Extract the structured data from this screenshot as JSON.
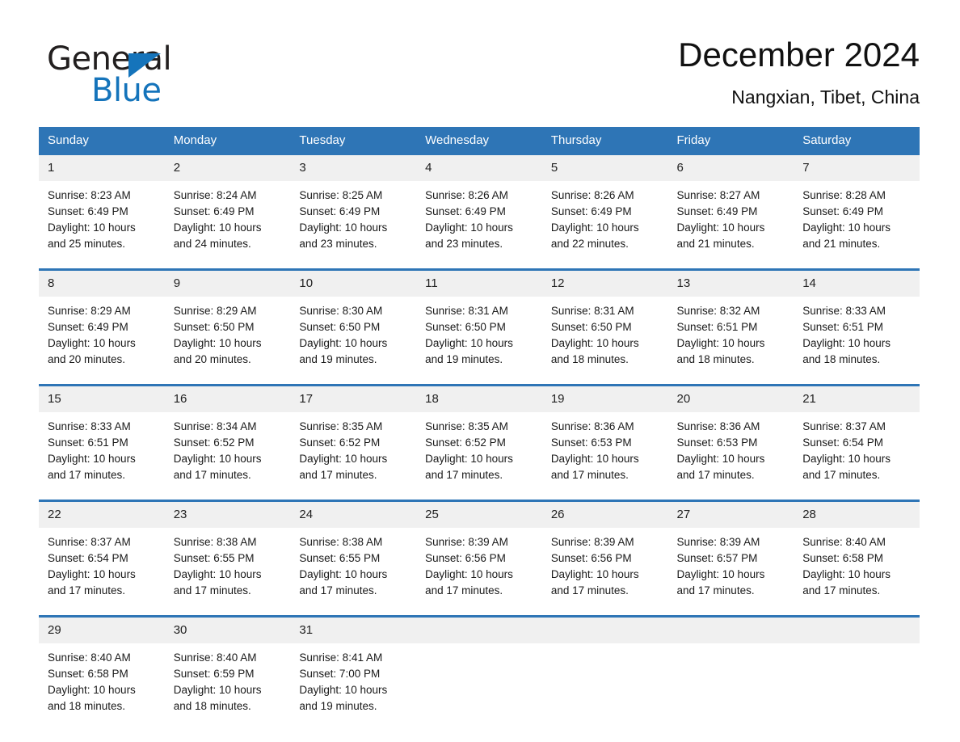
{
  "brand": {
    "name_part1": "General",
    "name_part2": "Blue",
    "triangle_color": "#1574bb",
    "text_color": "#221f1f"
  },
  "header": {
    "title": "December 2024",
    "subtitle": "Nangxian, Tibet, China"
  },
  "theme": {
    "header_bg": "#2e75b6",
    "header_text": "#ffffff",
    "daynum_bg": "#f0f0f0",
    "separator": "#2e75b6",
    "page_bg": "#ffffff"
  },
  "weekday_headers": [
    "Sunday",
    "Monday",
    "Tuesday",
    "Wednesday",
    "Thursday",
    "Friday",
    "Saturday"
  ],
  "weeks": [
    [
      {
        "day": "1",
        "sunrise": "Sunrise: 8:23 AM",
        "sunset": "Sunset: 6:49 PM",
        "daylight_1": "Daylight: 10 hours",
        "daylight_2": "and 25 minutes."
      },
      {
        "day": "2",
        "sunrise": "Sunrise: 8:24 AM",
        "sunset": "Sunset: 6:49 PM",
        "daylight_1": "Daylight: 10 hours",
        "daylight_2": "and 24 minutes."
      },
      {
        "day": "3",
        "sunrise": "Sunrise: 8:25 AM",
        "sunset": "Sunset: 6:49 PM",
        "daylight_1": "Daylight: 10 hours",
        "daylight_2": "and 23 minutes."
      },
      {
        "day": "4",
        "sunrise": "Sunrise: 8:26 AM",
        "sunset": "Sunset: 6:49 PM",
        "daylight_1": "Daylight: 10 hours",
        "daylight_2": "and 23 minutes."
      },
      {
        "day": "5",
        "sunrise": "Sunrise: 8:26 AM",
        "sunset": "Sunset: 6:49 PM",
        "daylight_1": "Daylight: 10 hours",
        "daylight_2": "and 22 minutes."
      },
      {
        "day": "6",
        "sunrise": "Sunrise: 8:27 AM",
        "sunset": "Sunset: 6:49 PM",
        "daylight_1": "Daylight: 10 hours",
        "daylight_2": "and 21 minutes."
      },
      {
        "day": "7",
        "sunrise": "Sunrise: 8:28 AM",
        "sunset": "Sunset: 6:49 PM",
        "daylight_1": "Daylight: 10 hours",
        "daylight_2": "and 21 minutes."
      }
    ],
    [
      {
        "day": "8",
        "sunrise": "Sunrise: 8:29 AM",
        "sunset": "Sunset: 6:49 PM",
        "daylight_1": "Daylight: 10 hours",
        "daylight_2": "and 20 minutes."
      },
      {
        "day": "9",
        "sunrise": "Sunrise: 8:29 AM",
        "sunset": "Sunset: 6:50 PM",
        "daylight_1": "Daylight: 10 hours",
        "daylight_2": "and 20 minutes."
      },
      {
        "day": "10",
        "sunrise": "Sunrise: 8:30 AM",
        "sunset": "Sunset: 6:50 PM",
        "daylight_1": "Daylight: 10 hours",
        "daylight_2": "and 19 minutes."
      },
      {
        "day": "11",
        "sunrise": "Sunrise: 8:31 AM",
        "sunset": "Sunset: 6:50 PM",
        "daylight_1": "Daylight: 10 hours",
        "daylight_2": "and 19 minutes."
      },
      {
        "day": "12",
        "sunrise": "Sunrise: 8:31 AM",
        "sunset": "Sunset: 6:50 PM",
        "daylight_1": "Daylight: 10 hours",
        "daylight_2": "and 18 minutes."
      },
      {
        "day": "13",
        "sunrise": "Sunrise: 8:32 AM",
        "sunset": "Sunset: 6:51 PM",
        "daylight_1": "Daylight: 10 hours",
        "daylight_2": "and 18 minutes."
      },
      {
        "day": "14",
        "sunrise": "Sunrise: 8:33 AM",
        "sunset": "Sunset: 6:51 PM",
        "daylight_1": "Daylight: 10 hours",
        "daylight_2": "and 18 minutes."
      }
    ],
    [
      {
        "day": "15",
        "sunrise": "Sunrise: 8:33 AM",
        "sunset": "Sunset: 6:51 PM",
        "daylight_1": "Daylight: 10 hours",
        "daylight_2": "and 17 minutes."
      },
      {
        "day": "16",
        "sunrise": "Sunrise: 8:34 AM",
        "sunset": "Sunset: 6:52 PM",
        "daylight_1": "Daylight: 10 hours",
        "daylight_2": "and 17 minutes."
      },
      {
        "day": "17",
        "sunrise": "Sunrise: 8:35 AM",
        "sunset": "Sunset: 6:52 PM",
        "daylight_1": "Daylight: 10 hours",
        "daylight_2": "and 17 minutes."
      },
      {
        "day": "18",
        "sunrise": "Sunrise: 8:35 AM",
        "sunset": "Sunset: 6:52 PM",
        "daylight_1": "Daylight: 10 hours",
        "daylight_2": "and 17 minutes."
      },
      {
        "day": "19",
        "sunrise": "Sunrise: 8:36 AM",
        "sunset": "Sunset: 6:53 PM",
        "daylight_1": "Daylight: 10 hours",
        "daylight_2": "and 17 minutes."
      },
      {
        "day": "20",
        "sunrise": "Sunrise: 8:36 AM",
        "sunset": "Sunset: 6:53 PM",
        "daylight_1": "Daylight: 10 hours",
        "daylight_2": "and 17 minutes."
      },
      {
        "day": "21",
        "sunrise": "Sunrise: 8:37 AM",
        "sunset": "Sunset: 6:54 PM",
        "daylight_1": "Daylight: 10 hours",
        "daylight_2": "and 17 minutes."
      }
    ],
    [
      {
        "day": "22",
        "sunrise": "Sunrise: 8:37 AM",
        "sunset": "Sunset: 6:54 PM",
        "daylight_1": "Daylight: 10 hours",
        "daylight_2": "and 17 minutes."
      },
      {
        "day": "23",
        "sunrise": "Sunrise: 8:38 AM",
        "sunset": "Sunset: 6:55 PM",
        "daylight_1": "Daylight: 10 hours",
        "daylight_2": "and 17 minutes."
      },
      {
        "day": "24",
        "sunrise": "Sunrise: 8:38 AM",
        "sunset": "Sunset: 6:55 PM",
        "daylight_1": "Daylight: 10 hours",
        "daylight_2": "and 17 minutes."
      },
      {
        "day": "25",
        "sunrise": "Sunrise: 8:39 AM",
        "sunset": "Sunset: 6:56 PM",
        "daylight_1": "Daylight: 10 hours",
        "daylight_2": "and 17 minutes."
      },
      {
        "day": "26",
        "sunrise": "Sunrise: 8:39 AM",
        "sunset": "Sunset: 6:56 PM",
        "daylight_1": "Daylight: 10 hours",
        "daylight_2": "and 17 minutes."
      },
      {
        "day": "27",
        "sunrise": "Sunrise: 8:39 AM",
        "sunset": "Sunset: 6:57 PM",
        "daylight_1": "Daylight: 10 hours",
        "daylight_2": "and 17 minutes."
      },
      {
        "day": "28",
        "sunrise": "Sunrise: 8:40 AM",
        "sunset": "Sunset: 6:58 PM",
        "daylight_1": "Daylight: 10 hours",
        "daylight_2": "and 17 minutes."
      }
    ],
    [
      {
        "day": "29",
        "sunrise": "Sunrise: 8:40 AM",
        "sunset": "Sunset: 6:58 PM",
        "daylight_1": "Daylight: 10 hours",
        "daylight_2": "and 18 minutes."
      },
      {
        "day": "30",
        "sunrise": "Sunrise: 8:40 AM",
        "sunset": "Sunset: 6:59 PM",
        "daylight_1": "Daylight: 10 hours",
        "daylight_2": "and 18 minutes."
      },
      {
        "day": "31",
        "sunrise": "Sunrise: 8:41 AM",
        "sunset": "Sunset: 7:00 PM",
        "daylight_1": "Daylight: 10 hours",
        "daylight_2": "and 19 minutes."
      },
      {
        "day": "",
        "sunrise": "",
        "sunset": "",
        "daylight_1": "",
        "daylight_2": ""
      },
      {
        "day": "",
        "sunrise": "",
        "sunset": "",
        "daylight_1": "",
        "daylight_2": ""
      },
      {
        "day": "",
        "sunrise": "",
        "sunset": "",
        "daylight_1": "",
        "daylight_2": ""
      },
      {
        "day": "",
        "sunrise": "",
        "sunset": "",
        "daylight_1": "",
        "daylight_2": ""
      }
    ]
  ]
}
